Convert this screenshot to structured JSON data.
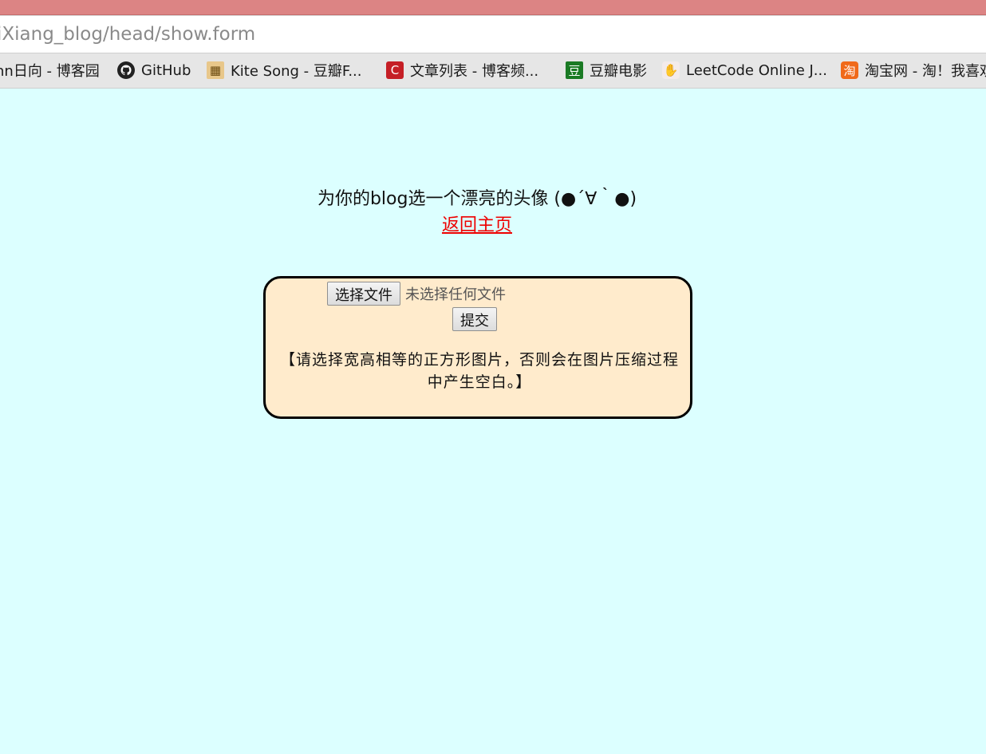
{
  "browser": {
    "url": "iXiang_blog/head/show.form",
    "bookmarks": [
      {
        "label": "nn日向 - 博客园",
        "icon": "none"
      },
      {
        "label": "GitHub",
        "icon": "github-icon"
      },
      {
        "label": "Kite Song - 豆瓣F...",
        "icon": "kite-icon"
      },
      {
        "label": "文章列表 - 博客频...",
        "icon": "csdn-icon"
      },
      {
        "label": "豆瓣电影",
        "icon": "douban-icon"
      },
      {
        "label": "LeetCode Online J...",
        "icon": "leetcode-icon"
      },
      {
        "label": "淘宝网 - 淘！我喜欢",
        "icon": "taobao-icon"
      }
    ]
  },
  "page": {
    "heading": "为你的blog选一个漂亮的头像 (●´∀｀●)",
    "home_link": "返回主页",
    "file_button": "选择文件",
    "file_status": "未选择任何文件",
    "submit_button": "提交",
    "note": "【请选择宽高相等的正方形图片，否则会在图片压缩过程中产生空白。】"
  },
  "colors": {
    "background": "#dcffff",
    "box_background": "#ffebcc",
    "link": "#ee0000"
  }
}
